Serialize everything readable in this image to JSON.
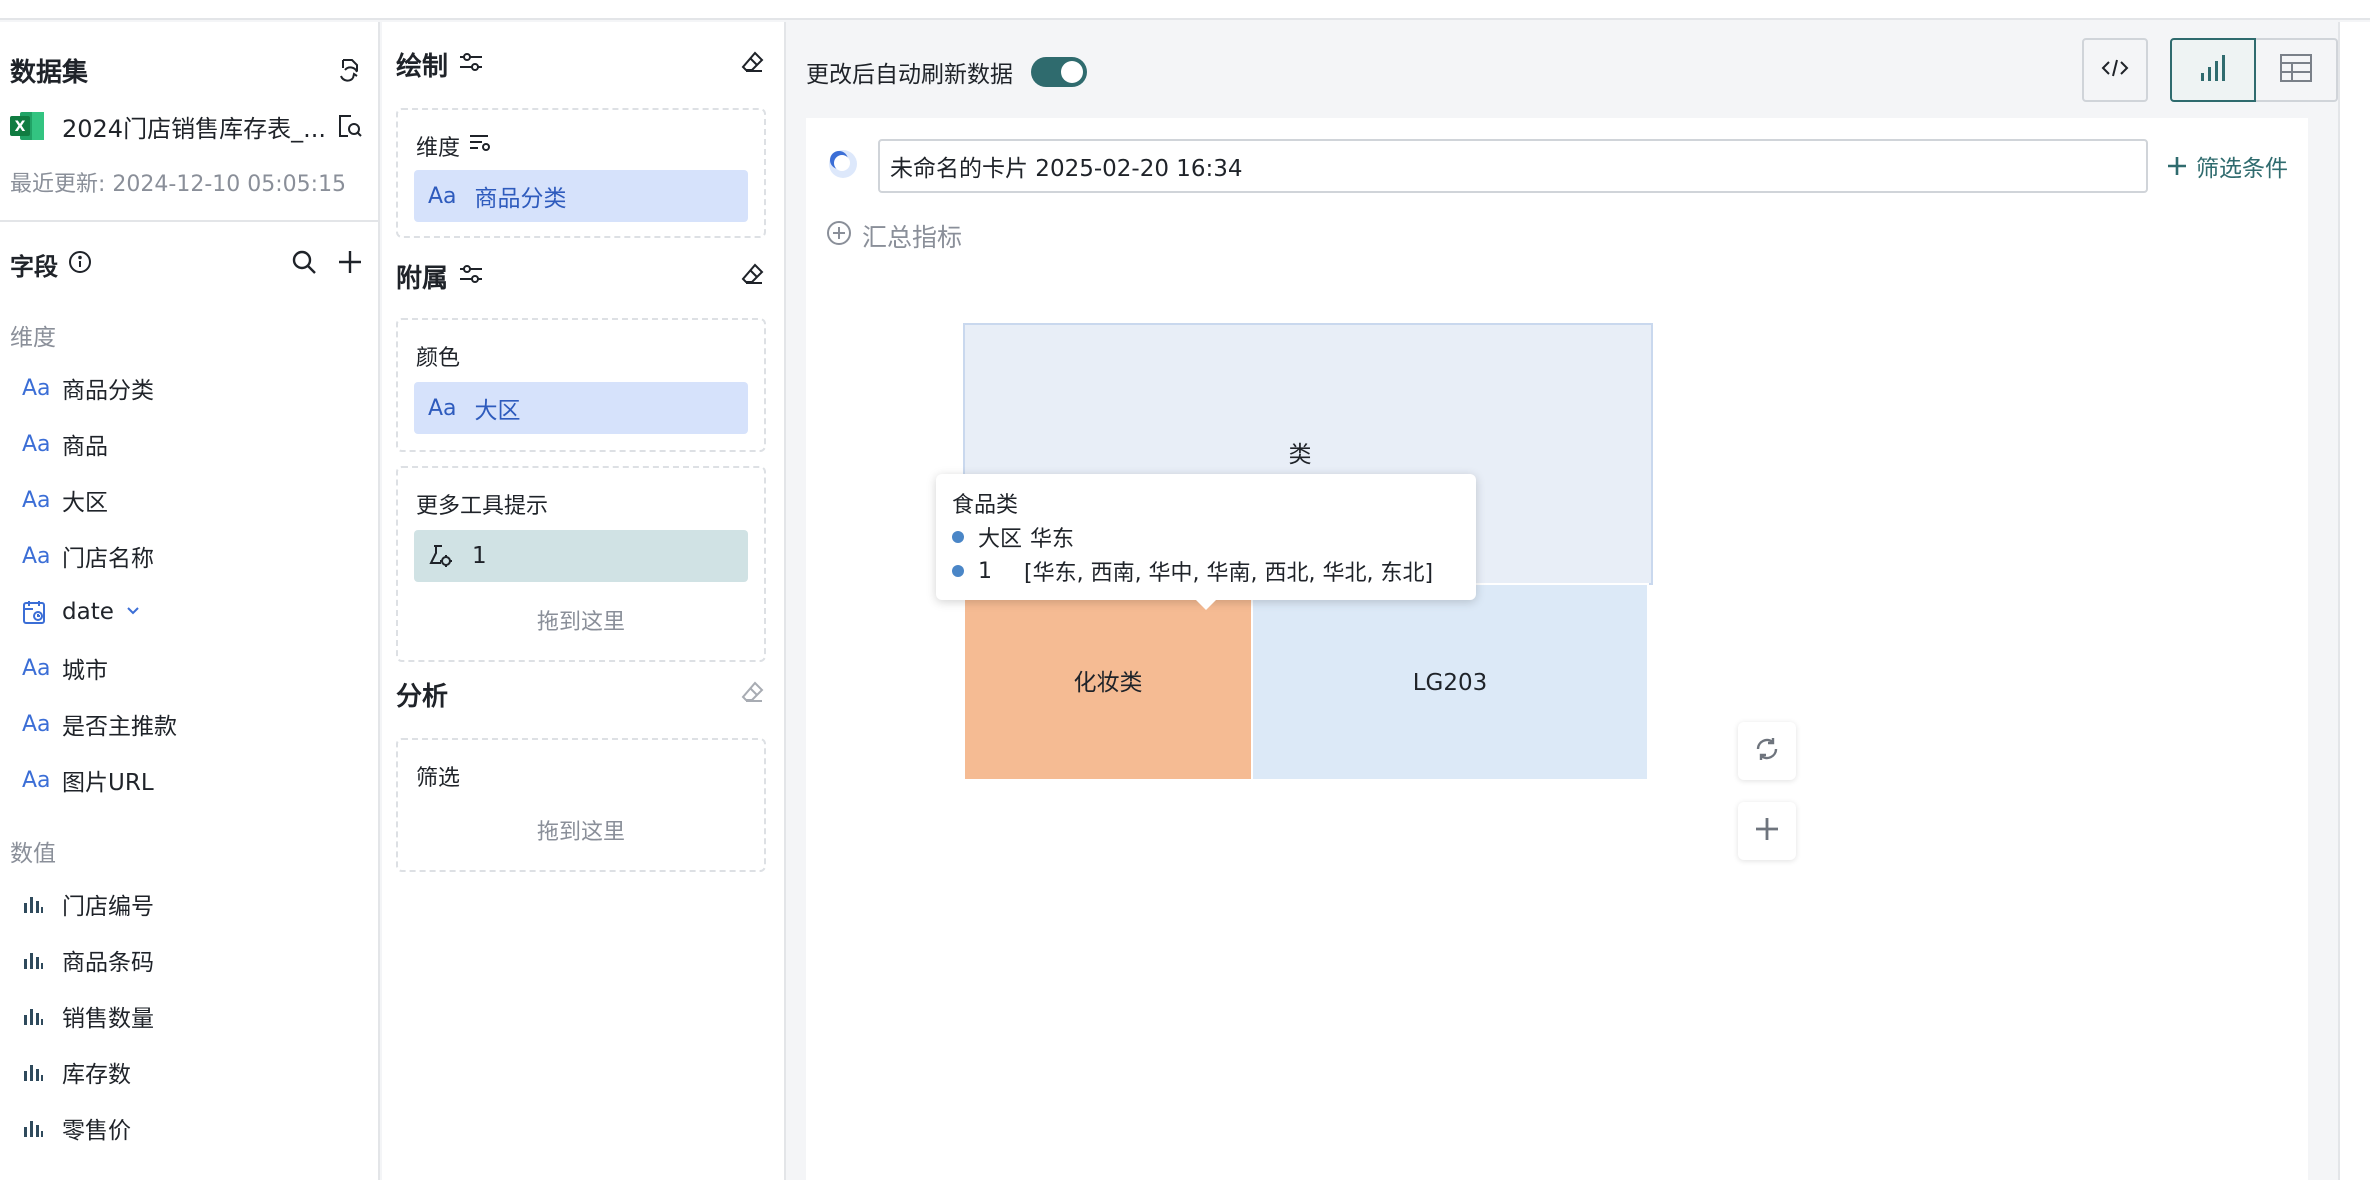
{
  "dataset": {
    "title": "数据集",
    "file_name": "2024门店销售库存表_...",
    "updated": "最近更新: 2024-12-10 05:05:15"
  },
  "fields": {
    "title": "字段",
    "dimension_label": "维度",
    "dimensions": [
      {
        "type": "Aa",
        "name": "商品分类"
      },
      {
        "type": "Aa",
        "name": "商品"
      },
      {
        "type": "Aa",
        "name": "大区"
      },
      {
        "type": "Aa",
        "name": "门店名称"
      },
      {
        "type": "date",
        "name": "date"
      },
      {
        "type": "Aa",
        "name": "城市"
      },
      {
        "type": "Aa",
        "name": "是否主推款"
      },
      {
        "type": "Aa",
        "name": "图片URL"
      }
    ],
    "measure_label": "数值",
    "measures": [
      {
        "name": "门店编号"
      },
      {
        "name": "商品条码"
      },
      {
        "name": "销售数量"
      },
      {
        "name": "库存数"
      },
      {
        "name": "零售价"
      }
    ]
  },
  "config": {
    "draw_title": "绘制",
    "dimension_box_label": "维度",
    "dimension_chip": "商品分类",
    "attach_title": "附属",
    "color_label": "颜色",
    "color_chip": "大区",
    "tooltip_label": "更多工具提示",
    "tooltip_chip": "1",
    "drop_hint": "拖到这里",
    "analysis_title": "分析",
    "filter_label": "筛选",
    "chip_prefix": "Aa"
  },
  "toolbar": {
    "auto_refresh_label": "更改后自动刷新数据",
    "auto_refresh_on": true
  },
  "card": {
    "title_value": "未命名的卡片 2025-02-20 16:34",
    "filter_button": "筛选条件",
    "summary_label": "汇总指标"
  },
  "chart_data": {
    "type": "treemap",
    "nodes": [
      {
        "label": "食品类",
        "color": "#e8eef7"
      },
      {
        "label": "化妆类",
        "color": "#f5bb93"
      },
      {
        "label": "LG203",
        "color": "#dce9f7"
      }
    ],
    "tooltip": {
      "title": "食品类",
      "rows": [
        {
          "key": "大区",
          "value": "华东"
        },
        {
          "key": "1",
          "value": "[华东, 西南, 华中, 华南, 西北, 华北, 东北]"
        }
      ]
    },
    "partial_label": "类"
  },
  "colors": {
    "accent": "#2f6b6e",
    "chip_blue": "#d6e2fb",
    "chip_teal": "#d0e2e4"
  }
}
